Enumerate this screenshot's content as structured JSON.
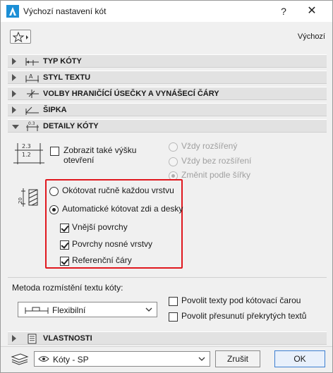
{
  "window": {
    "title": "Výchozí nastavení kót",
    "help": "?",
    "close": "✕"
  },
  "header": {
    "default_label": "Výchozí"
  },
  "sections": {
    "dim_type": "TYP KÓTY",
    "text_style": "STYL TEXTU",
    "boundary": "VOLBY HRANIČÍCÍ ÚSEČKY A VYNÁŠECÍ ČÁRY",
    "arrow": "ŠIPKA",
    "details": "DETAILY KÓTY",
    "properties": "VLASTNOSTI"
  },
  "details": {
    "icon_top": "2.3",
    "icon_bottom": "1.2",
    "show_height_line1": "Zobrazit také výšku",
    "show_height_line2": "otevření",
    "show_height_checked": false,
    "always_extended": "Vždy rozšířený",
    "always_not_extended": "Vždy bez rozšíření",
    "change_by_width": "Změnit podle šířky",
    "layer_icon_label": "20",
    "manual_each_layer": "Okótovat ručně každou vrstvu",
    "auto_walls_slabs": "Automatické kótovat zdi a desky",
    "outer_surfaces": "Vnější povrchy",
    "core_surfaces": "Povrchy nosné vrstvy",
    "reference_lines": "Referenční čáry",
    "placement_label": "Metoda rozmístění textu kóty:",
    "placement_value": "Flexibilní",
    "allow_below": "Povolit texty pod kótovací čarou",
    "allow_move_overlap": "Povolit přesunutí překrytých textů"
  },
  "footer": {
    "layer_value": "Kóty - SP",
    "cancel": "Zrušit",
    "ok": "OK"
  },
  "colors": {
    "highlight_box": "#e0181e",
    "ok_border": "#3c7fd1"
  }
}
